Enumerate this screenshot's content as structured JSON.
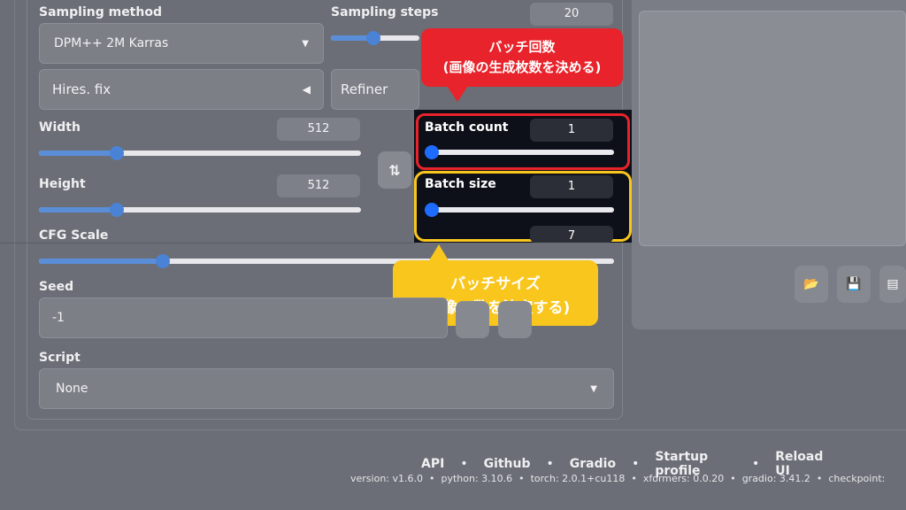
{
  "sampling": {
    "method_label": "Sampling method",
    "method_value": "DPM++ 2M Karras",
    "steps_label": "Sampling steps",
    "steps_value": "20"
  },
  "accordions": {
    "hires": "Hires. fix",
    "refiner": "Refiner"
  },
  "width": {
    "label": "Width",
    "value": "512"
  },
  "height": {
    "label": "Height",
    "value": "512"
  },
  "batch": {
    "count_label": "Batch count",
    "count_value": "1",
    "size_label": "Batch size",
    "size_value": "1"
  },
  "cfg": {
    "label": "CFG Scale",
    "value": "7"
  },
  "seed": {
    "label": "Seed",
    "value": "-1"
  },
  "script": {
    "label": "Script",
    "value": "None"
  },
  "callouts": {
    "count_line1": "バッチ回数",
    "count_line2": "(画像の生成枚数を決める)",
    "size_line1": "バッチサイズ",
    "size_line2": "(画像の数を決定する)"
  },
  "footer": {
    "links": [
      "API",
      "Github",
      "Gradio",
      "Startup profile",
      "Reload UI"
    ],
    "version": "version: v1.6.0  •  python: 3.10.6  •  torch: 2.0.1+cu118  •  xformers: 0.0.20  •  gradio: 3.41.2  •  checkpoint:"
  },
  "icons": {
    "swap": "swap-arrows-icon",
    "folder": "folder-icon",
    "save": "save-icon",
    "zip": "zip-icon"
  },
  "colors": {
    "callout_red": "#e8232b",
    "callout_yellow": "#f9c61d",
    "slider_thumb": "#1e6bff"
  }
}
